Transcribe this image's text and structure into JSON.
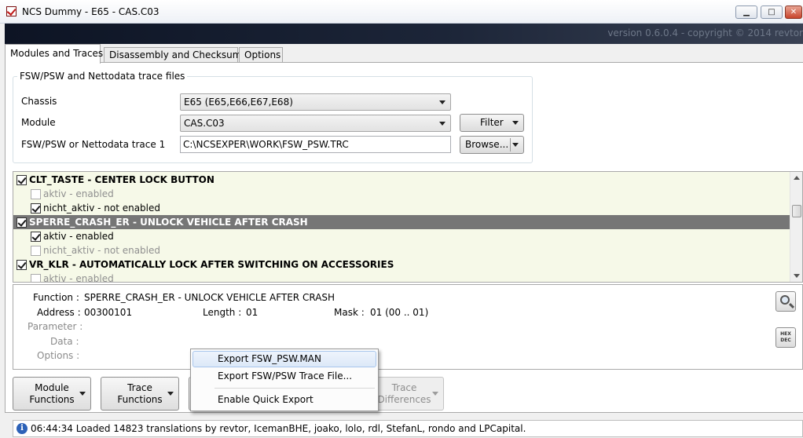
{
  "window": {
    "title": "NCS Dummy - E65 - CAS.C03",
    "minimize": "▁",
    "maximize": "□",
    "close": "✕"
  },
  "banner": {
    "version": "version 0.6.0.4 - copyright © 2014 revtor"
  },
  "tabs": [
    {
      "label": "Modules and Traces",
      "active": true
    },
    {
      "label": "Disassembly and Checksums",
      "active": false
    },
    {
      "label": "Options",
      "active": false
    }
  ],
  "group": {
    "title": "FSW/PSW and Nettodata trace files",
    "chassis_label": "Chassis",
    "chassis_value": "E65  (E65,E66,E67,E68)",
    "module_label": "Module",
    "module_value": "CAS.C03",
    "filter_label": "Filter",
    "trace_label": "FSW/PSW or Nettodata trace 1",
    "trace_value": "C:\\NCSEXPER\\WORK\\FSW_PSW.TRC",
    "browse_label": "Browse..."
  },
  "coding_list": [
    {
      "text": "CLT_TASTE  -  CENTER LOCK BUTTON",
      "header": true,
      "checked": true,
      "dim": false,
      "selected": false
    },
    {
      "text": "aktiv  -  enabled",
      "header": false,
      "checked": false,
      "dim": true,
      "selected": false
    },
    {
      "text": "nicht_aktiv  -  not enabled",
      "header": false,
      "checked": true,
      "dim": false,
      "selected": false
    },
    {
      "text": "SPERRE_CRASH_ER  -  UNLOCK VEHICLE AFTER CRASH",
      "header": true,
      "checked": true,
      "dim": false,
      "selected": true
    },
    {
      "text": "aktiv  -  enabled",
      "header": false,
      "checked": true,
      "dim": false,
      "selected": false
    },
    {
      "text": "nicht_aktiv  -  not enabled",
      "header": false,
      "checked": false,
      "dim": true,
      "selected": false
    },
    {
      "text": "VR_KLR  -  AUTOMATICALLY LOCK AFTER SWITCHING ON ACCESSORIES",
      "header": true,
      "checked": true,
      "dim": false,
      "selected": false
    },
    {
      "text": "aktiv  -  enabled",
      "header": false,
      "checked": false,
      "dim": true,
      "selected": false
    }
  ],
  "details": {
    "function_label": "Function :",
    "function_value": "SPERRE_CRASH_ER  -  UNLOCK VEHICLE AFTER CRASH",
    "address_label": "Address :",
    "address_value": "00300101",
    "length_label": "Length :",
    "length_value": "01",
    "mask_label": "Mask :",
    "mask_value": "01  (00 .. 01)",
    "parameter_label": "Parameter :",
    "data_label": "Data :",
    "options_label": "Options :",
    "hexdec_top": "HEX",
    "hexdec_bottom": "DEC"
  },
  "bottom_buttons": {
    "module_line1": "Module",
    "module_line2": "Functions",
    "trace_line1": "Trace",
    "trace_line2": "Functions",
    "diff_line1": "Trace",
    "diff_line2": "Differences"
  },
  "context_menu": {
    "items": [
      {
        "label": "Export FSW_PSW.MAN",
        "highlighted": true
      },
      {
        "label": "Export FSW/PSW Trace File...",
        "highlighted": false
      },
      {
        "label": "Enable Quick Export",
        "highlighted": false
      }
    ]
  },
  "status": {
    "icon": "i",
    "text": "06:44:34  Loaded 14823 translations by revtor, IcemanBHE, joako, lolo, rdl, StefanL, rondo and LPCapital."
  }
}
